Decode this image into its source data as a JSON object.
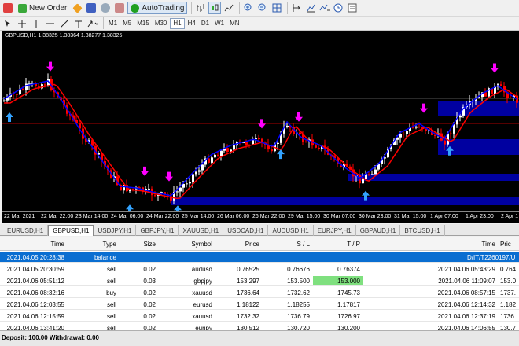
{
  "toolbar": {
    "new_order": "New Order",
    "autotrading": "AutoTrading"
  },
  "timeframes": [
    "H1",
    "M1",
    "M5",
    "M15",
    "M30",
    "H1",
    "H4",
    "D1",
    "W1",
    "MN"
  ],
  "chart": {
    "title": "GBPUSD,H1  1.38325 1.38364 1.38277 1.38325",
    "xticks": [
      "22 Mar 2021",
      "22 Mar 22:00",
      "23 Mar 14:00",
      "24 Mar 06:00",
      "24 Mar 22:00",
      "25 Mar 14:00",
      "26 Mar 06:00",
      "26 Mar 22:00",
      "29 Mar 15:00",
      "30 Mar 07:00",
      "30 Mar 23:00",
      "31 Mar 15:00",
      "1 Apr 07:00",
      "1 Apr 23:00",
      "2 Apr 1"
    ],
    "colors": {
      "bull": "#ffffff",
      "bear": "#ff0000",
      "fast_ma": "#0000ff",
      "slow_ma": "#ff0000",
      "buy_arrow": "#33a3ff",
      "sell_arrow": "#ff00ff",
      "zone": "#0000aa"
    }
  },
  "chart_tabs": [
    "EURUSD,H1",
    "GBPUSD,H1",
    "USDJPY,H1",
    "GBPJPY,H1",
    "XAUUSD,H1",
    "USDCAD,H1",
    "AUDUSD,H1",
    "EURJPY,H1",
    "GBPAUD,H1",
    "BTCUSD,H1"
  ],
  "active_tab": "GBPUSD,H1",
  "terminal": {
    "headers": [
      "Time",
      "Type",
      "Size",
      "Symbol",
      "Price",
      "S / L",
      "T / P",
      "Time",
      "Pric"
    ],
    "balance_row": {
      "time": "2021.04.05 20:28:38",
      "type": "balance",
      "comment": "D/IT/T2260197/U"
    },
    "rows": [
      {
        "time": "2021.04.05 20:30:59",
        "type": "sell",
        "size": "0.02",
        "symbol": "audusd",
        "price": "0.76525",
        "sl": "0.76676",
        "tp": "0.76374",
        "close_time": "2021.04.06 05:43:29",
        "close_price": "0.764"
      },
      {
        "time": "2021.04.06 05:51:12",
        "type": "sell",
        "size": "0.03",
        "symbol": "gbpjpy",
        "price": "153.297",
        "sl": "153.500",
        "tp": "153.000",
        "close_time": "2021.04.06 11:09:07",
        "close_price": "153.0"
      },
      {
        "time": "2021.04.06 08:32:16",
        "type": "buy",
        "size": "0.02",
        "symbol": "xauusd",
        "price": "1736.64",
        "sl": "1732.62",
        "tp": "1745.73",
        "close_time": "2021.04.06 08:57:15",
        "close_price": "1737."
      },
      {
        "time": "2021.04.06 12:03:55",
        "type": "sell",
        "size": "0.02",
        "symbol": "eurusd",
        "price": "1.18122",
        "sl": "1.18255",
        "tp": "1.17817",
        "close_time": "2021.04.06 12:14:32",
        "close_price": "1.182"
      },
      {
        "time": "2021.04.06 12:15:59",
        "type": "sell",
        "size": "0.02",
        "symbol": "xauusd",
        "price": "1732.32",
        "sl": "1736.79",
        "tp": "1726.97",
        "close_time": "2021.04.06 12:37:19",
        "close_price": "1736."
      },
      {
        "time": "2021.04.06 13:41:20",
        "type": "sell",
        "size": "0.02",
        "symbol": "eurjpy",
        "price": "130.512",
        "sl": "130.720",
        "tp": "130.200",
        "close_time": "2021.04.06 14:06:55",
        "close_price": "130.7"
      }
    ]
  },
  "status": {
    "text": "Deposit: 100.00  Withdrawal: 0.00"
  }
}
